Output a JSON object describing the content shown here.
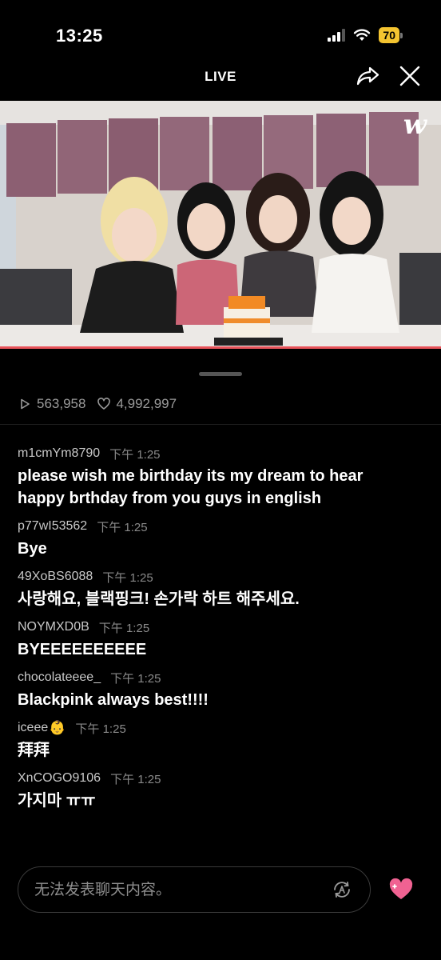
{
  "status_bar": {
    "time": "13:25",
    "battery": "70"
  },
  "header": {
    "title": "LIVE"
  },
  "video": {
    "logo": "w"
  },
  "stats": {
    "views": "563,958",
    "likes": "4,992,997"
  },
  "comments": [
    {
      "user": "m1cmYm8790",
      "time": "下午 1:25",
      "text": "please wish me birthday its my dream to hear",
      "text2": "happy brthday from you guys  in english"
    },
    {
      "user": "p77wI53562",
      "time": "下午 1:25",
      "text": "Bye"
    },
    {
      "user": "49XoBS6088",
      "time": "下午 1:25",
      "text": "사랑해요, 블랙핑크! 손가락 하트 해주세요."
    },
    {
      "user": "NOYMXD0B",
      "time": "下午 1:25",
      "text": "BYEEEEEEEEEE"
    },
    {
      "user": "chocolateeee_",
      "time": "下午 1:25",
      "text": "Blackpink always best!!!!"
    },
    {
      "user": "iceee",
      "user_emoji": "👶",
      "time": "下午 1:25",
      "text": "拜拜"
    },
    {
      "user": "XnCOGO9106",
      "time": "下午 1:25",
      "text": "가지마 ㅠㅠ"
    }
  ],
  "input": {
    "placeholder": "无法发表聊天内容。"
  },
  "icons": {
    "share": "share-icon",
    "close": "close-icon",
    "translate": "translate-icon",
    "heart": "heart-icon",
    "views": "play-icon",
    "likes": "heart-outline-icon"
  },
  "colors": {
    "accent": "#e8535a",
    "heart": "#f06292",
    "battery": "#f4c430"
  }
}
